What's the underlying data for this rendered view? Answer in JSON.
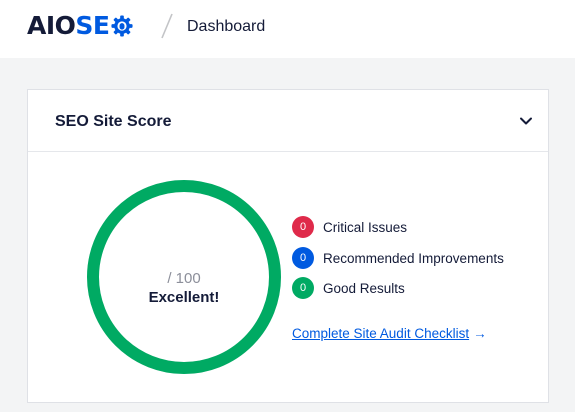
{
  "header": {
    "logo": {
      "part1": "AIO",
      "part2": "SE",
      "gear_icon": "gear-icon"
    },
    "breadcrumb_separator": "/",
    "page_title": "Dashboard"
  },
  "card": {
    "title": "SEO Site Score",
    "collapse_icon": "chevron-down-icon",
    "score": {
      "value_text": "/ 100",
      "rating": "Excellent!",
      "ring_color": "#00aa63",
      "fill_fraction": 1.0
    },
    "results": [
      {
        "count": "0",
        "label": "Critical Issues",
        "color": "#df2a4a"
      },
      {
        "count": "0",
        "label": "Recommended Improvements",
        "color": "#005ae0"
      },
      {
        "count": "0",
        "label": "Good Results",
        "color": "#00aa63"
      }
    ],
    "audit_link": {
      "label": "Complete Site Audit Checklist",
      "arrow": "→"
    }
  }
}
